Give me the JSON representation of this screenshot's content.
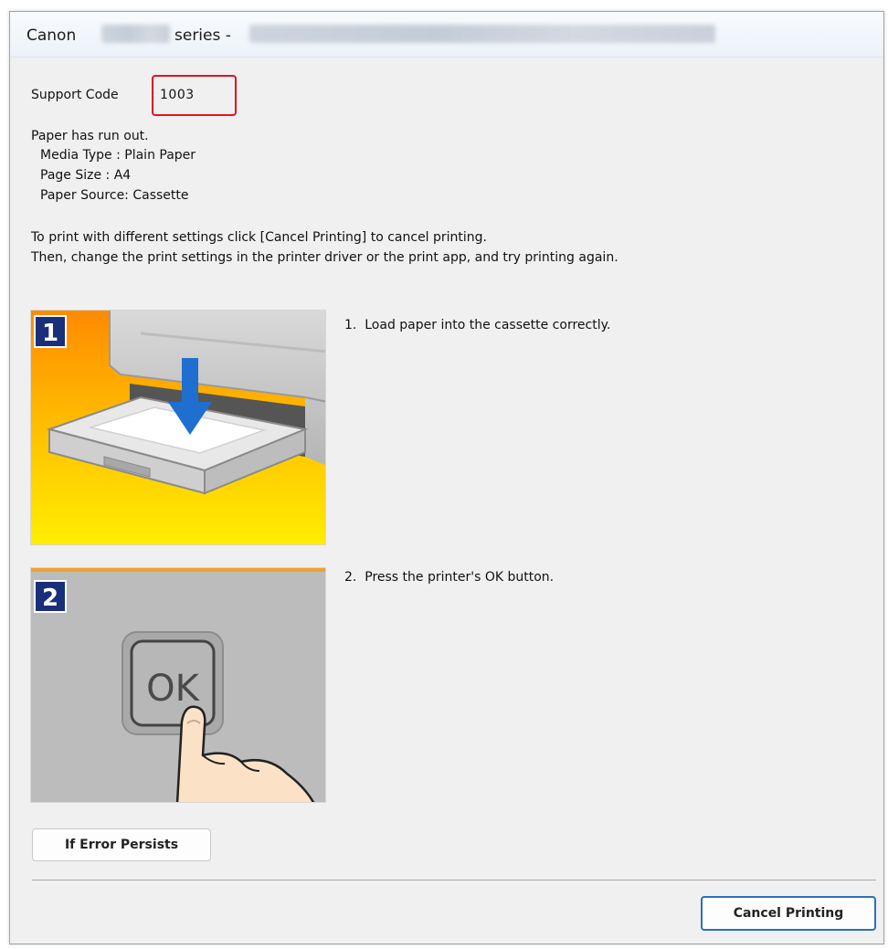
{
  "window": {
    "title_prefix": "Canon",
    "title_suffix": "series -"
  },
  "support": {
    "label": "Support Code",
    "separator": ":",
    "code": "1003"
  },
  "message": {
    "headline": "Paper has run out.",
    "details": [
      "Media Type : Plain Paper",
      "Page Size : A4",
      "Paper Source: Cassette"
    ],
    "instructions": [
      "To print with different settings click [Cancel Printing] to cancel printing.",
      "Then, change the print settings in the printer driver or the print app, and try printing again."
    ]
  },
  "steps": [
    {
      "badge": "1",
      "text": "1.  Load paper into the cassette correctly."
    },
    {
      "badge": "2",
      "text": "2.  Press the printer's OK button.",
      "button_label": "OK"
    }
  ],
  "buttons": {
    "if_error_persists": "If Error Persists",
    "cancel_printing": "Cancel Printing"
  },
  "colors": {
    "highlight": "#e0141e",
    "accent": "#2f6fb8",
    "badge_bg": "#1a2f7a",
    "arrow": "#1f6fd0"
  }
}
